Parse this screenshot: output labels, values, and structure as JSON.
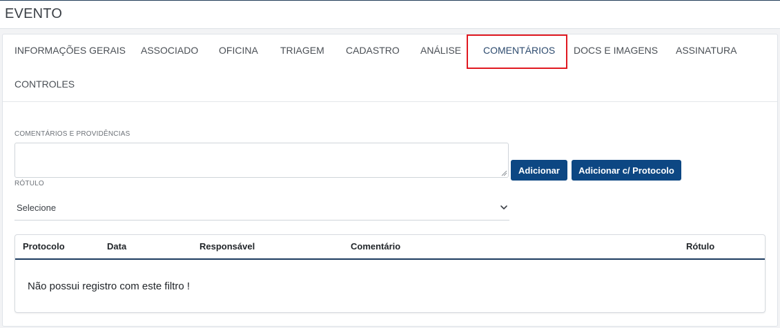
{
  "page": {
    "title": "EVENTO"
  },
  "tabs": [
    {
      "label": "INFORMAÇÕES GERAIS",
      "active": false
    },
    {
      "label": "ASSOCIADO",
      "active": false
    },
    {
      "label": "OFICINA",
      "active": false
    },
    {
      "label": "TRIAGEM",
      "active": false
    },
    {
      "label": "CADASTRO",
      "active": false
    },
    {
      "label": "ANÁLISE",
      "active": false
    },
    {
      "label": "COMENTÁRIOS",
      "active": true
    },
    {
      "label": "DOCS E IMAGENS",
      "active": false
    },
    {
      "label": "ASSINATURA",
      "active": false
    },
    {
      "label": "CONTROLES",
      "active": false
    }
  ],
  "form": {
    "comments_label": "COMENTÁRIOS E PROVIDÊNCIAS",
    "comments_value": "",
    "rotulo_label": "RÓTULO",
    "rotulo_selected": "Selecione",
    "add_button": "Adicionar",
    "add_protocol_button": "Adicionar c/ Protocolo"
  },
  "table": {
    "columns": [
      "Protocolo",
      "Data",
      "Responsável",
      "Comentário",
      "Rótulo"
    ],
    "rows": [],
    "empty_message": "Não possui registro com este filtro !"
  },
  "colors": {
    "primary_button": "#0d4783",
    "active_tab_text": "#2c4a6e",
    "highlight_box": "#e0171f",
    "table_header_rule": "#1b3a5e"
  },
  "icons": {
    "select_chevron": "chevron-down-icon",
    "textarea_grip": "resize-grip-icon"
  }
}
